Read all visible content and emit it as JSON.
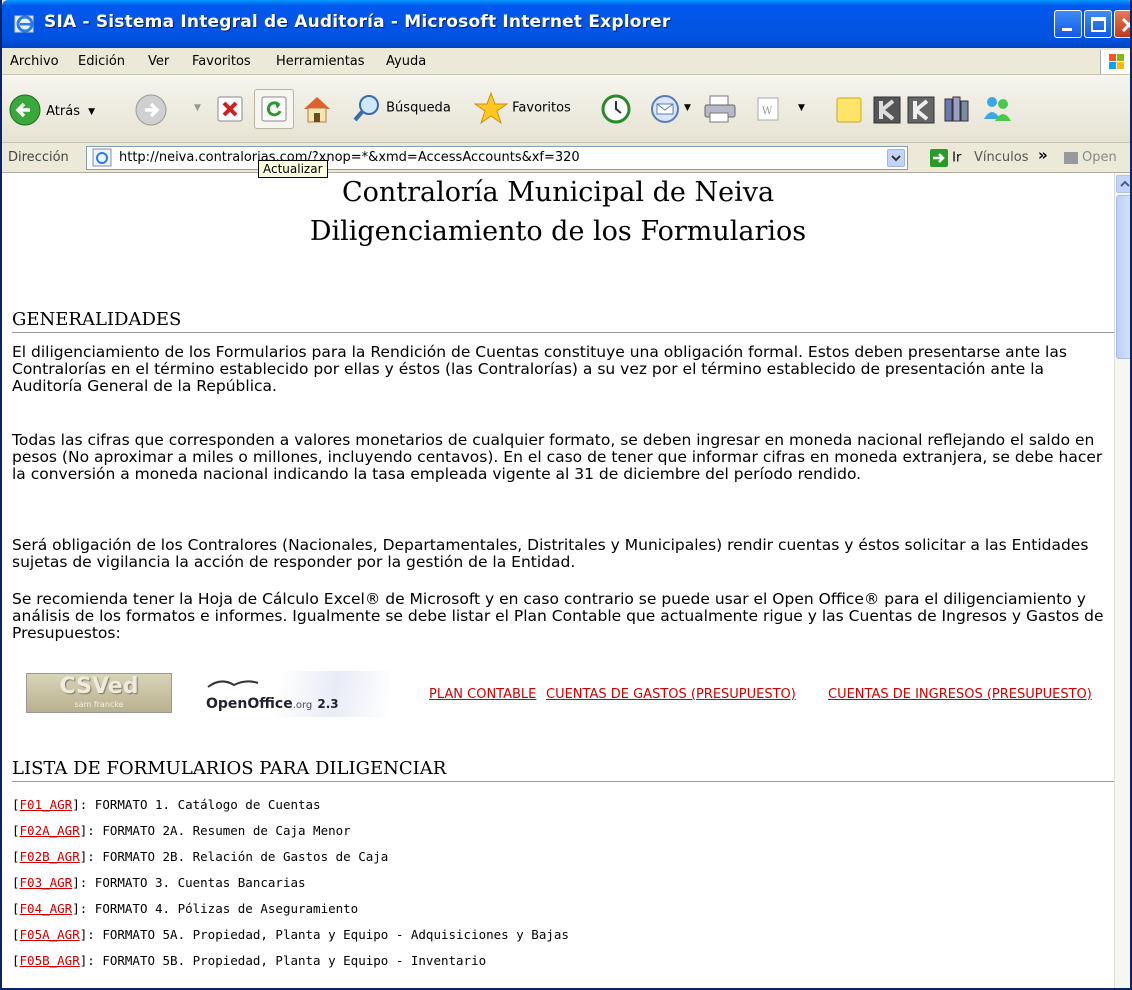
{
  "window": {
    "title": "SIA - Sistema Integral de Auditoría - Microsoft Internet Explorer"
  },
  "menu": {
    "items": [
      "Archivo",
      "Edición",
      "Ver",
      "Favoritos",
      "Herramientas",
      "Ayuda"
    ]
  },
  "toolbar": {
    "back_label": "Atrás",
    "search_label": "Búsqueda",
    "favorites_label": "Favoritos"
  },
  "address": {
    "label": "Dirección",
    "url": "http://neiva.contralorias.com/?xnop=*&xmd=AccessAccounts&xf=320",
    "go_label": "Ir",
    "links_label": "Vínculos",
    "open_label": "Open"
  },
  "tooltip": "Actualizar",
  "page": {
    "title_line1": "Contraloría Municipal de Neiva",
    "title_line2": "Diligenciamiento de los Formularios",
    "section1": "GENERALIDADES",
    "paragraphs": [
      "El diligenciamiento de los Formularios para la Rendición de Cuentas constituye una obligación formal. Estos deben presentarse ante las Contralorías en el término establecido por ellas y éstos (las Contralorías) a su vez por el término establecido de presentación ante la Auditoría General de la República.",
      "Todas las cifras que corresponden a valores monetarios de cualquier formato, se deben ingresar en moneda nacional reflejando el saldo en pesos (No aproximar a miles o millones, incluyendo centavos). En el caso de tener que informar cifras en moneda extranjera, se debe hacer la conversión a moneda nacional indicando la tasa empleada vigente al 31 de diciembre del período rendido.",
      "Será obligación de los Contralores (Nacionales, Departamentales, Distritales y Municipales) rendir cuentas y éstos solicitar a las Entidades sujetas de vigilancia la acción de responder por la gestión de la Entidad.",
      "Se recomienda tener la Hoja de Cálculo Excel® de Microsoft y en caso contrario se puede usar el Open Office® para el diligenciamiento y análisis de los formatos e informes. Igualmente se debe listar el Plan Contable que actualmente rigue y las Cuentas de Ingresos y Gastos de Presupuestos:"
    ],
    "logo_csved": "CSVed",
    "logo_csved_sub": "sam francke",
    "logo_oo": "OpenOffice",
    "logo_oo_org": ".org",
    "logo_oo_ver": "2.3",
    "links": [
      "PLAN CONTABLE",
      "CUENTAS DE GASTOS (PRESUPUESTO)",
      "CUENTAS DE INGRESOS (PRESUPUESTO)"
    ],
    "section2": "LISTA DE FORMULARIOS PARA DILIGENCIAR",
    "forms": [
      {
        "code": "F01_AGR",
        "desc": "FORMATO 1. Catálogo de Cuentas"
      },
      {
        "code": "F02A_AGR",
        "desc": "FORMATO 2A. Resumen de Caja Menor"
      },
      {
        "code": "F02B_AGR",
        "desc": "FORMATO 2B. Relación de Gastos de Caja"
      },
      {
        "code": "F03_AGR",
        "desc": "FORMATO 3. Cuentas Bancarias"
      },
      {
        "code": "F04_AGR",
        "desc": "FORMATO 4. Pólizas de Aseguramiento"
      },
      {
        "code": "F05A_AGR",
        "desc": "FORMATO 5A. Propiedad, Planta y Equipo - Adquisiciones y Bajas"
      },
      {
        "code": "F05B_AGR",
        "desc": "FORMATO 5B. Propiedad, Planta y Equipo - Inventario"
      }
    ]
  }
}
